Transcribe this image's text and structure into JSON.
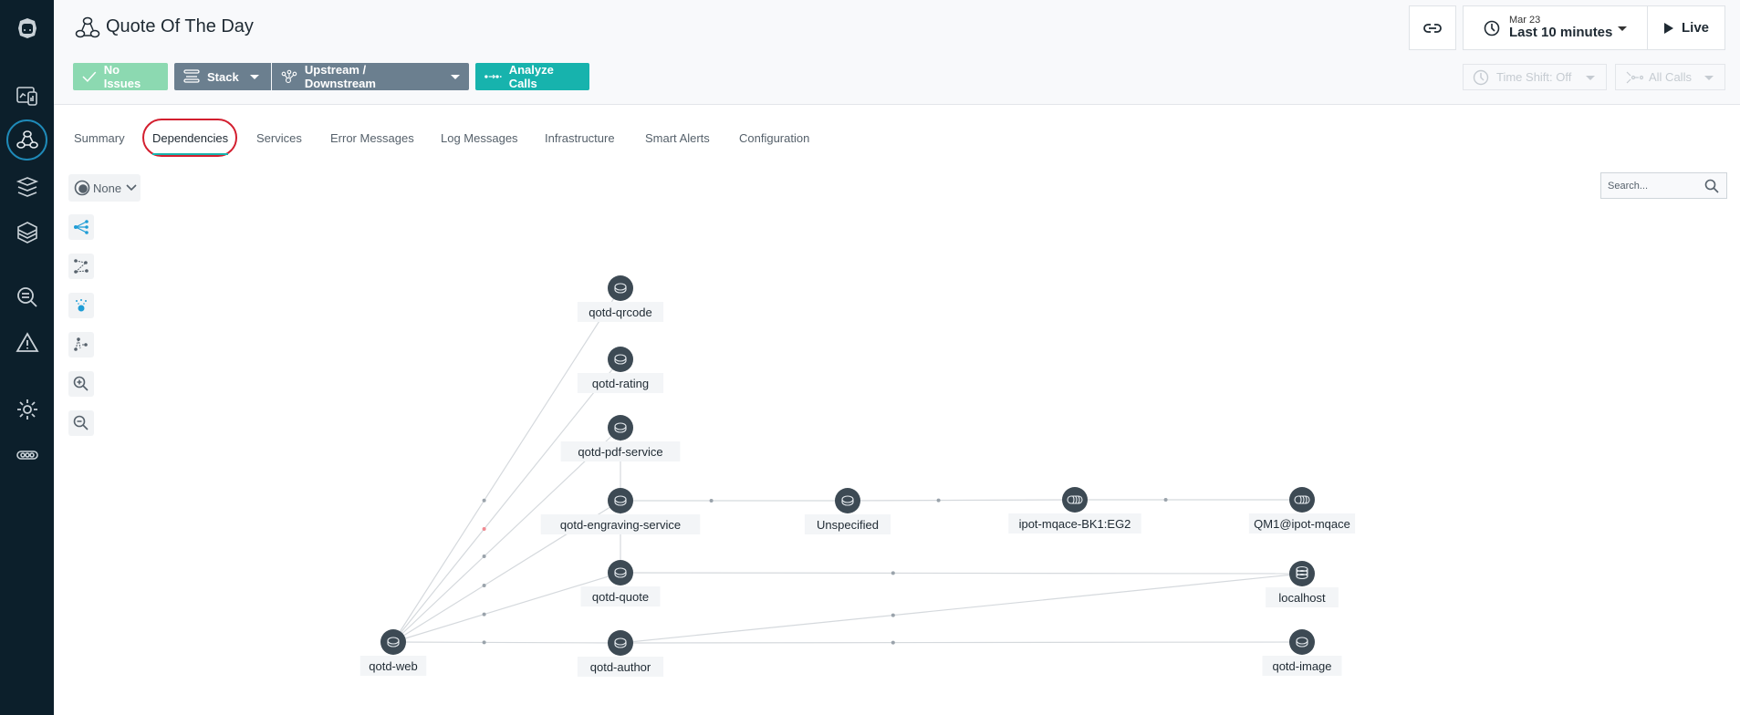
{
  "sidebar": {
    "items": [
      {
        "name": "logo-icon"
      },
      {
        "name": "websites-mobile-icon"
      },
      {
        "name": "applications-icon",
        "active": true
      },
      {
        "name": "platforms-icon"
      },
      {
        "name": "infrastructure-icon"
      },
      {
        "name": "analytics-icon"
      },
      {
        "name": "events-icon"
      },
      {
        "name": "settings-icon"
      },
      {
        "name": "more-icon"
      }
    ]
  },
  "header": {
    "title": "Quote Of The Day",
    "buttons": {
      "no_issues": "No Issues",
      "stack": "Stack",
      "upstream_downstream": "Upstream / Downstream",
      "analyze_calls": "Analyze Calls"
    },
    "time": {
      "date": "Mar 23",
      "range": "Last 10 minutes",
      "live": "Live"
    },
    "time_shift": "Time Shift: Off",
    "all_calls": "All Calls"
  },
  "tabs": [
    {
      "label": "Summary"
    },
    {
      "label": "Dependencies",
      "active": true
    },
    {
      "label": "Services"
    },
    {
      "label": "Error Messages"
    },
    {
      "label": "Log Messages"
    },
    {
      "label": "Infrastructure"
    },
    {
      "label": "Smart Alerts"
    },
    {
      "label": "Configuration"
    }
  ],
  "canvas": {
    "grouping": "None",
    "search_placeholder": "Search...",
    "tools": [
      "layout-hierarchy-icon",
      "layout-force-icon",
      "highlight-icon",
      "layout-flow-icon",
      "zoom-in-icon",
      "zoom-out-icon"
    ]
  },
  "graph": {
    "nodes": [
      {
        "id": "qotd-qrcode",
        "label": "qotd-qrcode",
        "type": "database"
      },
      {
        "id": "qotd-rating",
        "label": "qotd-rating",
        "type": "database"
      },
      {
        "id": "qotd-pdf-service",
        "label": "qotd-pdf-service",
        "type": "database"
      },
      {
        "id": "qotd-engraving-service",
        "label": "qotd-engraving-service",
        "type": "database"
      },
      {
        "id": "Unspecified",
        "label": "Unspecified",
        "type": "database"
      },
      {
        "id": "ipot-mqace-BK1:EG2",
        "label": "ipot-mqace-BK1:EG2",
        "type": "queue"
      },
      {
        "id": "QM1@ipot-mqace",
        "label": "QM1@ipot-mqace",
        "type": "queue"
      },
      {
        "id": "qotd-quote",
        "label": "qotd-quote",
        "type": "database"
      },
      {
        "id": "localhost",
        "label": "localhost",
        "type": "db-stack"
      },
      {
        "id": "qotd-web",
        "label": "qotd-web",
        "type": "database"
      },
      {
        "id": "qotd-author",
        "label": "qotd-author",
        "type": "database"
      },
      {
        "id": "qotd-image",
        "label": "qotd-image",
        "type": "database"
      }
    ],
    "edges": [
      {
        "from": "qotd-web",
        "to": "qotd-qrcode"
      },
      {
        "from": "qotd-web",
        "to": "qotd-rating",
        "status": "error"
      },
      {
        "from": "qotd-web",
        "to": "qotd-pdf-service"
      },
      {
        "from": "qotd-web",
        "to": "qotd-engraving-service"
      },
      {
        "from": "qotd-web",
        "to": "qotd-quote"
      },
      {
        "from": "qotd-web",
        "to": "qotd-author"
      },
      {
        "from": "qotd-pdf-service",
        "to": "qotd-engraving-service"
      },
      {
        "from": "qotd-engraving-service",
        "to": "qotd-quote"
      },
      {
        "from": "qotd-engraving-service",
        "to": "Unspecified"
      },
      {
        "from": "Unspecified",
        "to": "ipot-mqace-BK1:EG2"
      },
      {
        "from": "ipot-mqace-BK1:EG2",
        "to": "QM1@ipot-mqace"
      },
      {
        "from": "qotd-quote",
        "to": "localhost"
      },
      {
        "from": "qotd-author",
        "to": "localhost"
      },
      {
        "from": "qotd-author",
        "to": "qotd-image"
      }
    ]
  },
  "colors": {
    "sidebar_bg": "#0c1f2b",
    "accent_teal": "#17b3ad",
    "node_fill": "#3d4a54",
    "edge": "#d5d9dd",
    "error_dot": "#f08a92",
    "highlight_red": "#d31f2f"
  }
}
